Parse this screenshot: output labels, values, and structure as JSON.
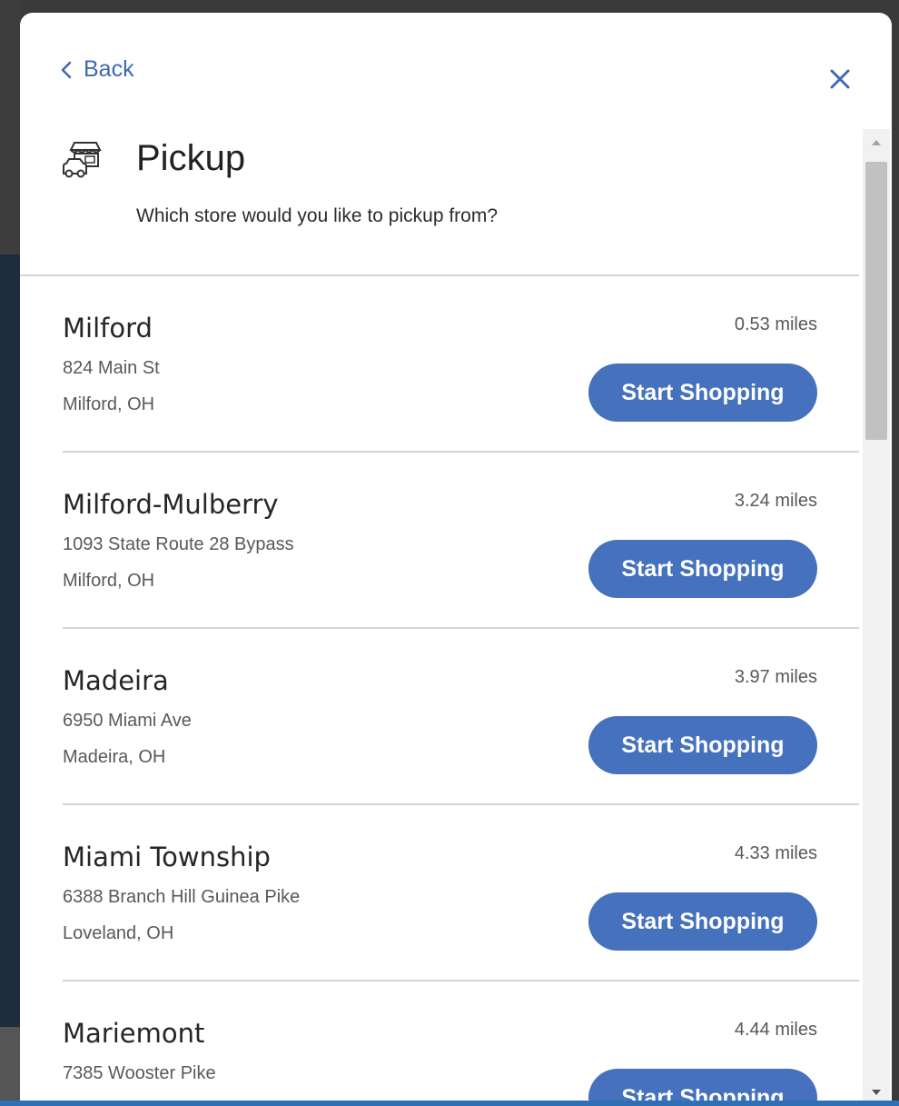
{
  "nav": {
    "back_label": "Back"
  },
  "header": {
    "title": "Pickup",
    "subtitle": "Which store would you like to pickup from?",
    "icon": "store-icon"
  },
  "colors": {
    "accent": "#4571bd",
    "link": "#3f6ab2"
  },
  "stores": [
    {
      "name": "Milford",
      "address_line1": "824 Main St",
      "address_line2": "Milford, OH",
      "distance": "0.53 miles",
      "button_label": "Start Shopping"
    },
    {
      "name": "Milford-Mulberry",
      "address_line1": "1093 State Route 28 Bypass",
      "address_line2": "Milford, OH",
      "distance": "3.24 miles",
      "button_label": "Start Shopping"
    },
    {
      "name": "Madeira",
      "address_line1": "6950 Miami Ave",
      "address_line2": "Madeira, OH",
      "distance": "3.97 miles",
      "button_label": "Start Shopping"
    },
    {
      "name": "Miami Township",
      "address_line1": "6388 Branch Hill Guinea Pike",
      "address_line2": "Loveland, OH",
      "distance": "4.33 miles",
      "button_label": "Start Shopping"
    },
    {
      "name": "Mariemont",
      "address_line1": "7385 Wooster Pike",
      "address_line2": "",
      "distance": "4.44 miles",
      "button_label": "Start Shopping"
    }
  ]
}
